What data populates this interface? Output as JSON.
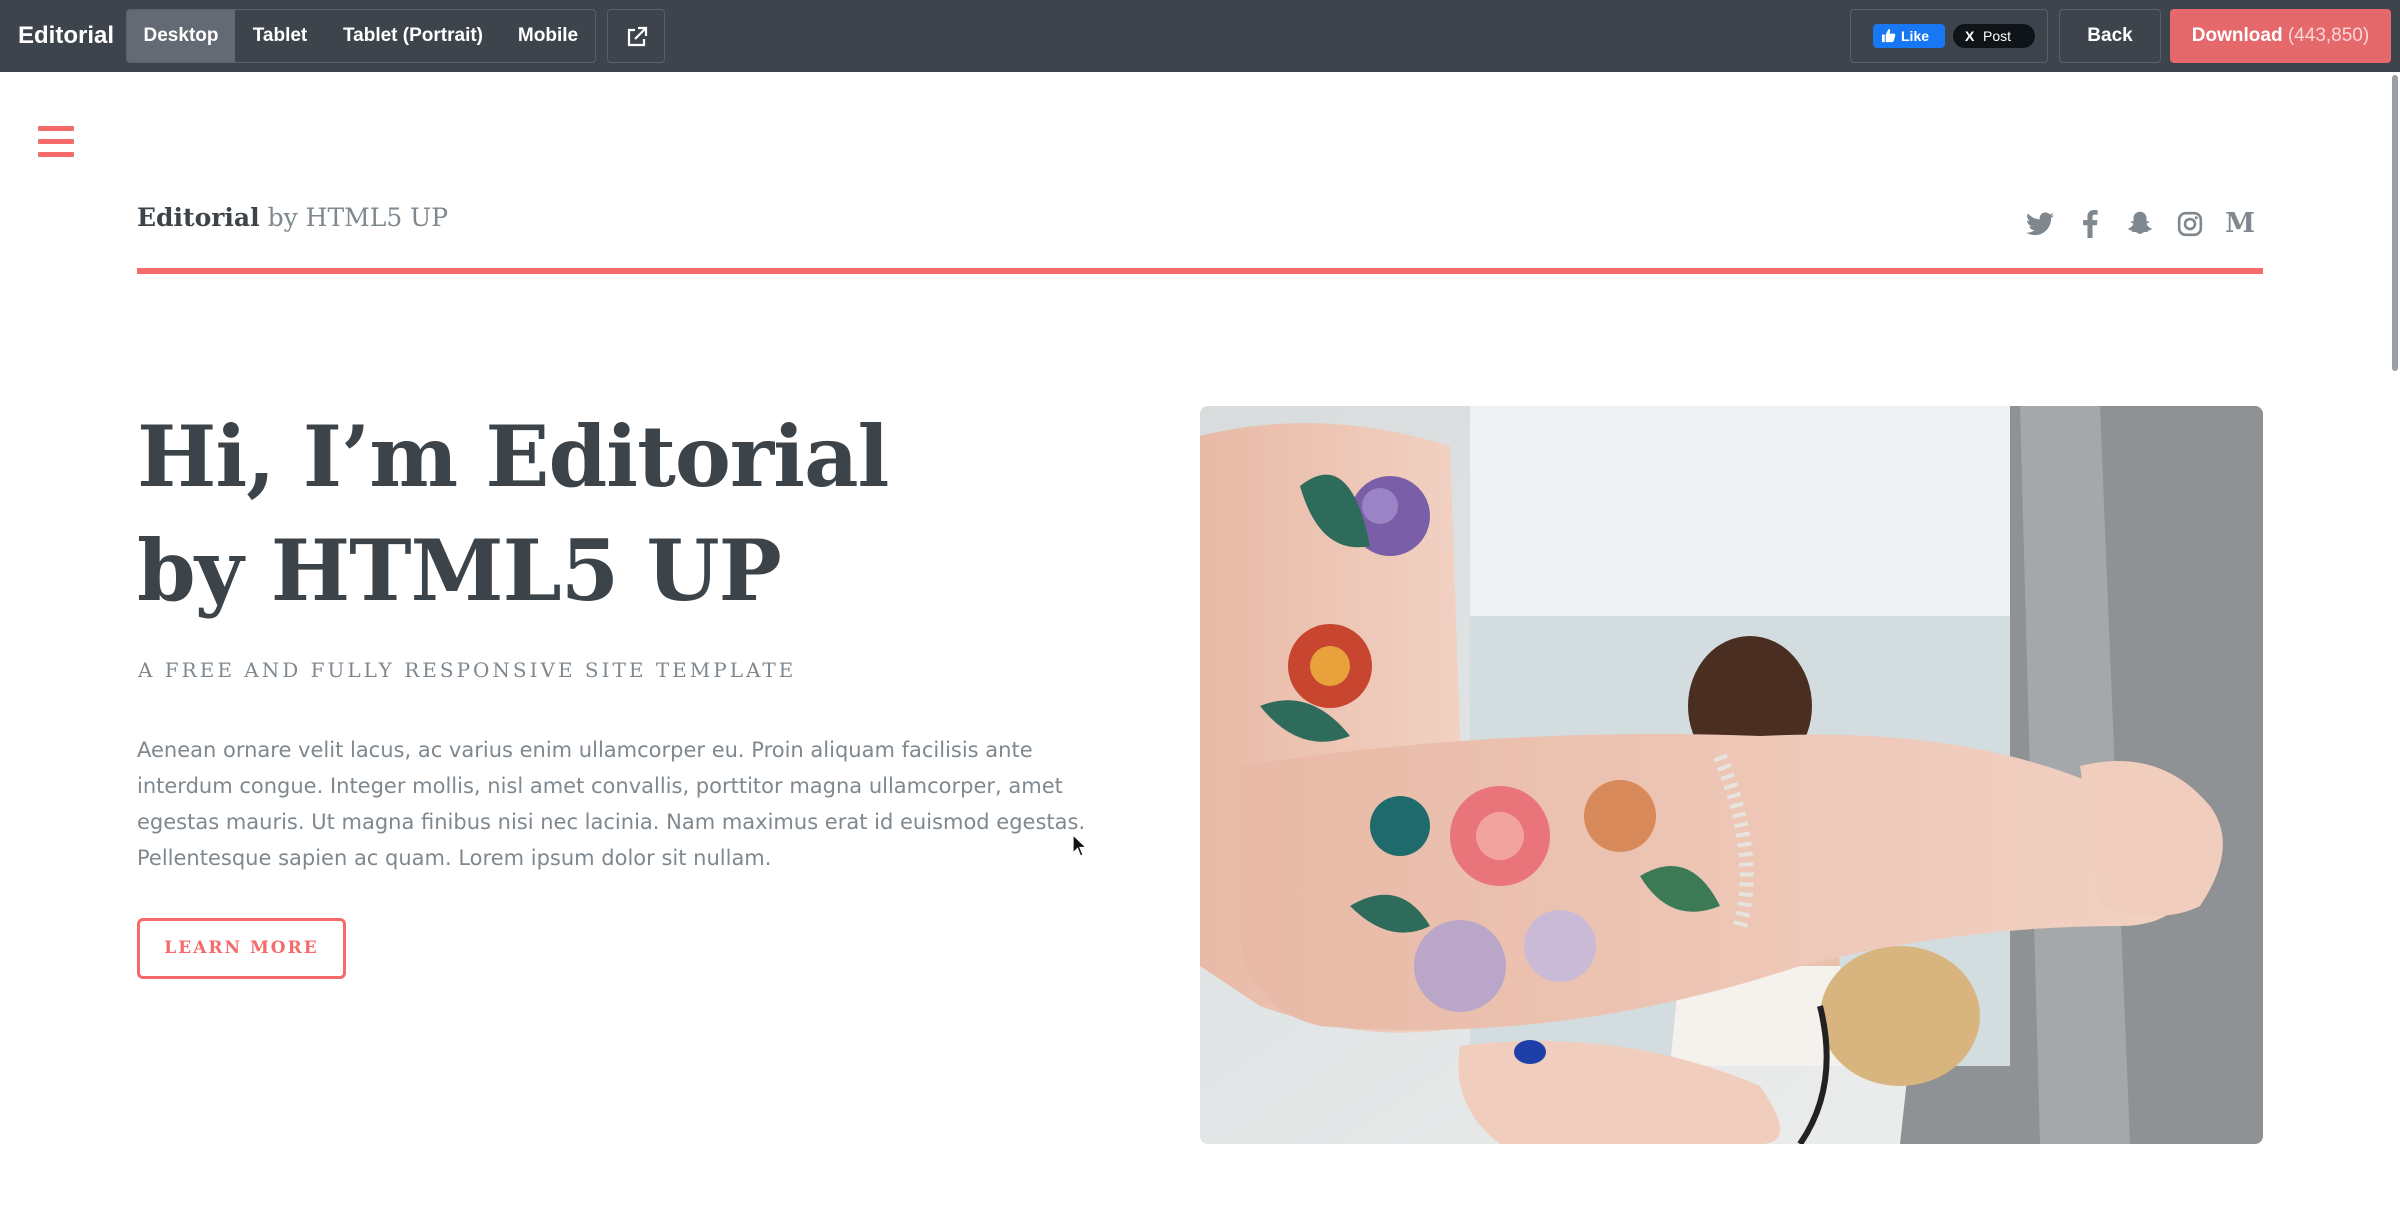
{
  "topbar": {
    "brand": "Editorial",
    "viewports": [
      "Desktop",
      "Tablet",
      "Tablet (Portrait)",
      "Mobile"
    ],
    "active_viewport": "Desktop",
    "fb_like_label": "Like",
    "x_post_label": "Post",
    "x_glyph": "X",
    "back_label": "Back",
    "download_label": "Download",
    "download_count": "(443,850)"
  },
  "site": {
    "logo_strong": "Editorial",
    "logo_rest": "by HTML5 UP",
    "social_icons": [
      "twitter-icon",
      "facebook-icon",
      "snapchat-icon",
      "instagram-icon",
      "medium-icon"
    ],
    "medium_glyph": "M"
  },
  "hero": {
    "title_line1": "Hi, I’m Editorial",
    "title_line2": "by HTML5 UP",
    "subtitle": "A FREE AND FULLY RESPONSIVE SITE TEMPLATE",
    "body": "Aenean ornare velit lacus, ac varius enim ullamcorper eu. Proin aliquam facilisis ante interdum congue. Integer mollis, nisl amet convallis, porttitor magna ullamcorper, amet egestas mauris. Ut magna finibus nisi nec lacinia. Nam maximus erat id euismod egestas. Pellentesque sapien ac quam. Lorem ipsum dolor sit nullam.",
    "button_label": "LEARN MORE"
  },
  "colors": {
    "accent": "#f56a6a",
    "topbar_bg": "#3e444c",
    "download_bg": "#e5686b",
    "heading": "#3d4449",
    "body_text": "#7f888f"
  }
}
